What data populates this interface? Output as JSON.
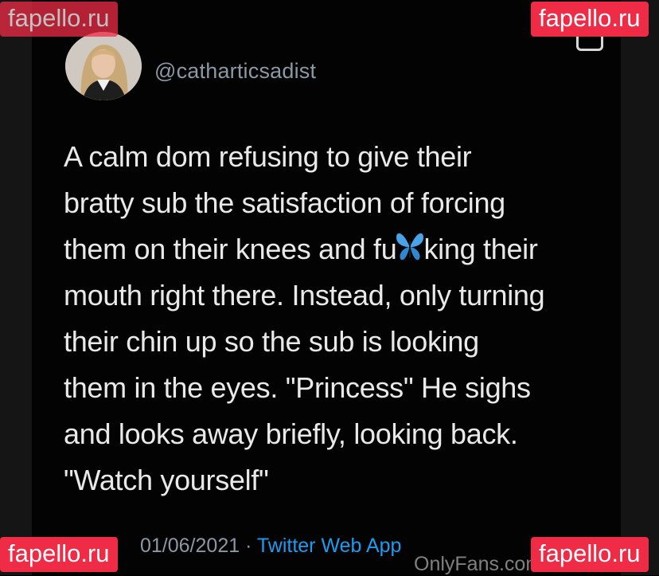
{
  "tweet": {
    "handle": "@catharticsadist",
    "lines": [
      "A calm dom refusing to give their",
      "bratty sub the satisfaction of forcing",
      "them on their knees and ",
      "mouth right there. Instead, only turning",
      "their chin up so the sub is looking",
      "them in the eyes. \"Princess\" He sighs",
      "and looks away briefly, looking back.",
      "\"Watch yourself\""
    ],
    "line3_pre": "fu",
    "line3_post": "king their",
    "emoji": "butterfly-emoji",
    "date": "01/06/2021 · ",
    "source": "Twitter Web App"
  },
  "watermarks": {
    "fapello": "fapello.ru",
    "onlyfans": "OnlyFans.com/"
  },
  "colors": {
    "background": "#030303",
    "text": "#e9e9e9",
    "muted": "#8b98a5",
    "link": "#1d9bf0",
    "watermark": "#f02b46",
    "butterfly": "#4aa3e8"
  }
}
